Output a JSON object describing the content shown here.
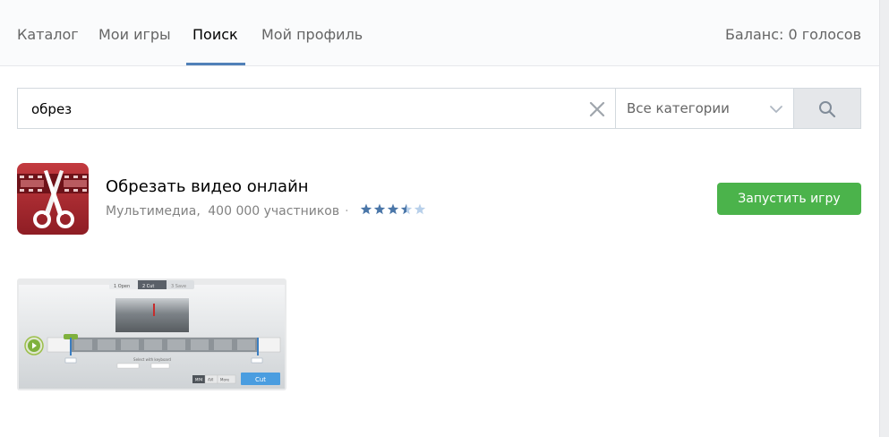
{
  "tabs": [
    {
      "label": "Каталог"
    },
    {
      "label": "Мои игры"
    },
    {
      "label": "Поиск"
    },
    {
      "label": "Мой профиль"
    }
  ],
  "active_tab": "Поиск",
  "balance": "Баланс: 0 голосов",
  "search": {
    "query": "обрез",
    "category": "Все категории"
  },
  "result": {
    "title": "Обрезать видео онлайн",
    "category": "Мультимедиа,",
    "members": "400 000 участников",
    "rating": 3.5,
    "launch_label": "Запустить игру"
  },
  "thumbnail": {
    "step1": "1  Open",
    "step2": "2  Cut",
    "step3": "3  Save",
    "hint": "Select with keyboard",
    "cut_label": "Cut",
    "format1": "MP4",
    "format2": "AVI",
    "format3": "More"
  },
  "colors": {
    "accent": "#5181b8",
    "button_green": "#4bb34b",
    "icon_red": "#a5252c"
  }
}
